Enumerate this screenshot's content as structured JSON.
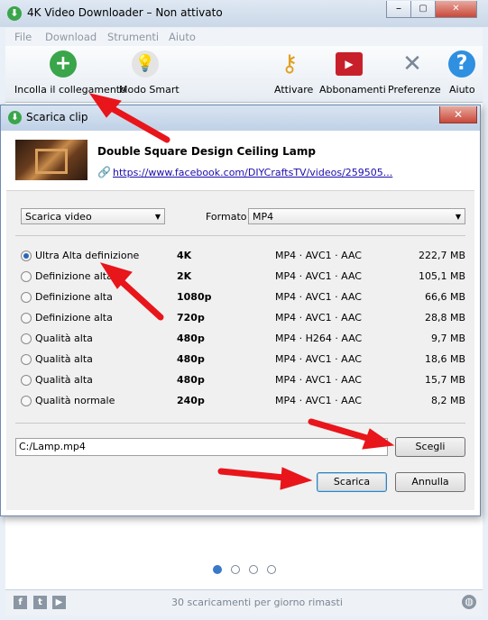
{
  "window": {
    "title": "4K Video Downloader – Non attivato",
    "min": "⎯",
    "max": "▢",
    "close": "✕"
  },
  "menu": [
    "File",
    "Download",
    "Strumenti",
    "Aiuto"
  ],
  "toolbar": {
    "paste_label": "Incolla il collegamento",
    "smart_label": "Modo Smart",
    "activate_label": "Attivare",
    "subscriptions_label": "Abbonamenti",
    "preferences_label": "Preferenze",
    "help_label": "Aiuto"
  },
  "status": {
    "text": "30 scaricamenti per giorno rimasti"
  },
  "dialog": {
    "title": "Scarica clip",
    "clip_title": "Double Square Design Ceiling Lamp",
    "clip_url": "https://www.facebook.com/DIYCraftsTV/videos/259505...",
    "action_select": "Scarica video",
    "format_label": "Formato",
    "format_select": "MP4",
    "options": [
      {
        "label": "Ultra Alta definizione",
        "res": "4K",
        "codec": "MP4 · AVC1 · AAC",
        "size": "222,7 MB",
        "checked": true
      },
      {
        "label": "Definizione alta",
        "res": "2K",
        "codec": "MP4 · AVC1 · AAC",
        "size": "105,1 MB",
        "checked": false
      },
      {
        "label": "Definizione alta",
        "res": "1080p",
        "codec": "MP4 · AVC1 · AAC",
        "size": "66,6 MB",
        "checked": false
      },
      {
        "label": "Definizione alta",
        "res": "720p",
        "codec": "MP4 · AVC1 · AAC",
        "size": "28,8 MB",
        "checked": false
      },
      {
        "label": "Qualità alta",
        "res": "480p",
        "codec": "MP4 · H264 · AAC",
        "size": "9,7 MB",
        "checked": false
      },
      {
        "label": "Qualità alta",
        "res": "480p",
        "codec": "MP4 · AVC1 · AAC",
        "size": "18,6 MB",
        "checked": false
      },
      {
        "label": "Qualità alta",
        "res": "480p",
        "codec": "MP4 · AVC1 · AAC",
        "size": "15,7 MB",
        "checked": false
      },
      {
        "label": "Qualità normale",
        "res": "240p",
        "codec": "MP4 · AVC1 · AAC",
        "size": "8,2 MB",
        "checked": false
      }
    ],
    "path_value": "C:/Lamp.mp4",
    "choose_label": "Scegli",
    "download_label": "Scarica",
    "cancel_label": "Annulla"
  },
  "colors": {
    "annotation_arrow": "#e8151b",
    "accent_blue": "#2a67b3"
  }
}
